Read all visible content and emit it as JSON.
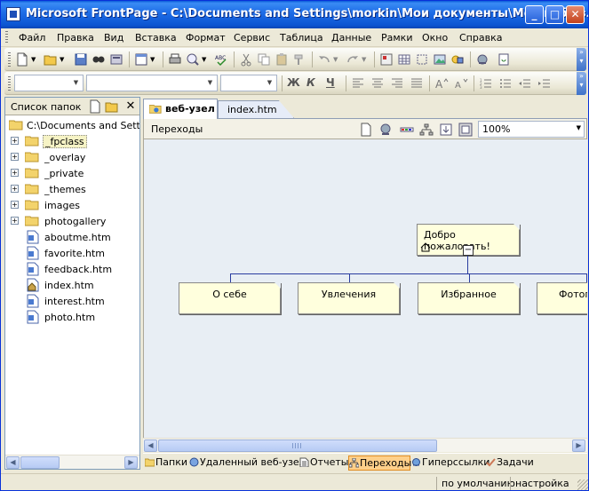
{
  "window": {
    "title": "Microsoft FrontPage - C:\\Documents and Settings\\morkin\\Мои документы\\Мои веб-узл..."
  },
  "menubar": {
    "items": [
      {
        "label": "Файл"
      },
      {
        "label": "Правка"
      },
      {
        "label": "Вид"
      },
      {
        "label": "Вставка"
      },
      {
        "label": "Формат"
      },
      {
        "label": "Сервис"
      },
      {
        "label": "Таблица"
      },
      {
        "label": "Данные"
      },
      {
        "label": "Рамки"
      },
      {
        "label": "Окно"
      },
      {
        "label": "Справка"
      }
    ]
  },
  "format_toolbar": {
    "bold": "Ж",
    "italic": "К",
    "underline": "Ч"
  },
  "folder_pane": {
    "title": "Список папок",
    "root": "C:\\Documents and Settings",
    "items": [
      {
        "label": "_fpclass",
        "kind": "folder",
        "expandable": true,
        "selected": true
      },
      {
        "label": "_overlay",
        "kind": "folder",
        "expandable": true
      },
      {
        "label": "_private",
        "kind": "folder",
        "expandable": true
      },
      {
        "label": "_themes",
        "kind": "folder",
        "expandable": true
      },
      {
        "label": "images",
        "kind": "folder",
        "expandable": true
      },
      {
        "label": "photogallery",
        "kind": "folder",
        "expandable": true
      },
      {
        "label": "aboutme.htm",
        "kind": "file"
      },
      {
        "label": "favorite.htm",
        "kind": "file"
      },
      {
        "label": "feedback.htm",
        "kind": "file"
      },
      {
        "label": "index.htm",
        "kind": "home-file"
      },
      {
        "label": "interest.htm",
        "kind": "file"
      },
      {
        "label": "photo.htm",
        "kind": "file"
      }
    ]
  },
  "tabs": [
    {
      "label": "веб-узел",
      "active": true
    },
    {
      "label": "index.htm",
      "active": false
    }
  ],
  "view_bar": {
    "title": "Переходы",
    "zoom": "100%"
  },
  "navigation": {
    "home": "Добро пожаловать!",
    "children": [
      "О себе",
      "Увлечения",
      "Избранное",
      "Фотог"
    ]
  },
  "views_bar": {
    "items": [
      {
        "label": "Папки",
        "active": false
      },
      {
        "label": "Удаленный веб-узел",
        "active": false
      },
      {
        "label": "Отчеты",
        "active": false
      },
      {
        "label": "Переходы",
        "active": true
      },
      {
        "label": "Гиперссылки",
        "active": false
      },
      {
        "label": "Задачи",
        "active": false
      }
    ]
  },
  "statusbar": {
    "cell1": "по умолчанию",
    "cell2": "настройка"
  },
  "colors": {
    "title_blue": "#0c55d2",
    "nav_box": "#ffffdd",
    "canvas": "#e8eef4",
    "active_view": "#ffd08a"
  }
}
